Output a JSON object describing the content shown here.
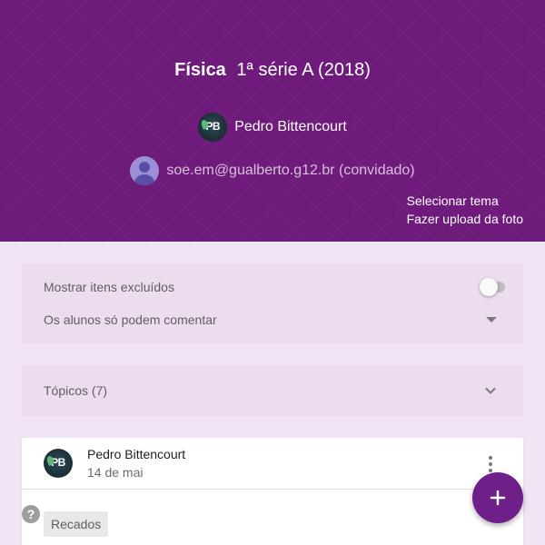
{
  "header": {
    "course_name": "Física",
    "course_class": "1ª série A (2018)",
    "teacher_name": "Pedro Bittencourt",
    "teacher_initials": "PB",
    "guest_label": "soe.em@gualberto.g12.br (convidado)",
    "select_theme_label": "Selecionar tema",
    "upload_photo_label": "Fazer upload da foto",
    "background_color": "#6f1b7c"
  },
  "settings": {
    "show_deleted_label": "Mostrar itens excluídos",
    "show_deleted_on": false,
    "comment_permission_value": "Os alunos só podem comentar"
  },
  "topics": {
    "label": "Tópicos (7)"
  },
  "post": {
    "author": "Pedro Bittencourt",
    "author_initials": "PB",
    "date": "14 de mai",
    "tag": "Recados"
  },
  "icons": {
    "help": "help-icon",
    "more": "more-vert-icon",
    "add": "add-icon",
    "chevron": "chevron-down-icon",
    "dropdown": "dropdown-arrow-icon"
  },
  "colors": {
    "accent": "#6e1f8a",
    "page_background": "#f1e4f5",
    "card_background": "#ebdded"
  }
}
